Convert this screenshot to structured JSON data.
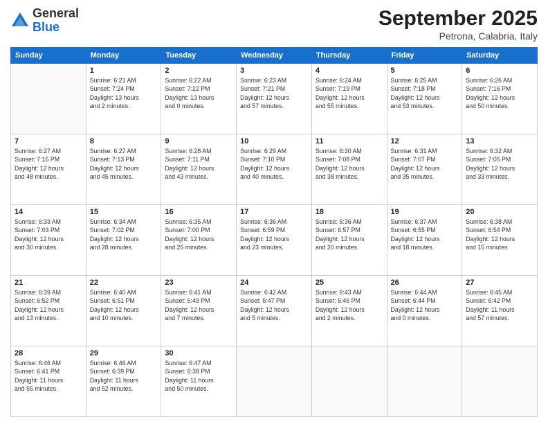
{
  "logo": {
    "general": "General",
    "blue": "Blue"
  },
  "header": {
    "month": "September 2025",
    "location": "Petrona, Calabria, Italy"
  },
  "weekdays": [
    "Sunday",
    "Monday",
    "Tuesday",
    "Wednesday",
    "Thursday",
    "Friday",
    "Saturday"
  ],
  "weeks": [
    [
      {
        "day": "",
        "info": ""
      },
      {
        "day": "1",
        "info": "Sunrise: 6:21 AM\nSunset: 7:24 PM\nDaylight: 13 hours\nand 2 minutes."
      },
      {
        "day": "2",
        "info": "Sunrise: 6:22 AM\nSunset: 7:22 PM\nDaylight: 13 hours\nand 0 minutes."
      },
      {
        "day": "3",
        "info": "Sunrise: 6:23 AM\nSunset: 7:21 PM\nDaylight: 12 hours\nand 57 minutes."
      },
      {
        "day": "4",
        "info": "Sunrise: 6:24 AM\nSunset: 7:19 PM\nDaylight: 12 hours\nand 55 minutes."
      },
      {
        "day": "5",
        "info": "Sunrise: 6:25 AM\nSunset: 7:18 PM\nDaylight: 12 hours\nand 53 minutes."
      },
      {
        "day": "6",
        "info": "Sunrise: 6:26 AM\nSunset: 7:16 PM\nDaylight: 12 hours\nand 50 minutes."
      }
    ],
    [
      {
        "day": "7",
        "info": "Sunrise: 6:27 AM\nSunset: 7:15 PM\nDaylight: 12 hours\nand 48 minutes."
      },
      {
        "day": "8",
        "info": "Sunrise: 6:27 AM\nSunset: 7:13 PM\nDaylight: 12 hours\nand 45 minutes."
      },
      {
        "day": "9",
        "info": "Sunrise: 6:28 AM\nSunset: 7:11 PM\nDaylight: 12 hours\nand 43 minutes."
      },
      {
        "day": "10",
        "info": "Sunrise: 6:29 AM\nSunset: 7:10 PM\nDaylight: 12 hours\nand 40 minutes."
      },
      {
        "day": "11",
        "info": "Sunrise: 6:30 AM\nSunset: 7:08 PM\nDaylight: 12 hours\nand 38 minutes."
      },
      {
        "day": "12",
        "info": "Sunrise: 6:31 AM\nSunset: 7:07 PM\nDaylight: 12 hours\nand 35 minutes."
      },
      {
        "day": "13",
        "info": "Sunrise: 6:32 AM\nSunset: 7:05 PM\nDaylight: 12 hours\nand 33 minutes."
      }
    ],
    [
      {
        "day": "14",
        "info": "Sunrise: 6:33 AM\nSunset: 7:03 PM\nDaylight: 12 hours\nand 30 minutes."
      },
      {
        "day": "15",
        "info": "Sunrise: 6:34 AM\nSunset: 7:02 PM\nDaylight: 12 hours\nand 28 minutes."
      },
      {
        "day": "16",
        "info": "Sunrise: 6:35 AM\nSunset: 7:00 PM\nDaylight: 12 hours\nand 25 minutes."
      },
      {
        "day": "17",
        "info": "Sunrise: 6:36 AM\nSunset: 6:59 PM\nDaylight: 12 hours\nand 23 minutes."
      },
      {
        "day": "18",
        "info": "Sunrise: 6:36 AM\nSunset: 6:57 PM\nDaylight: 12 hours\nand 20 minutes."
      },
      {
        "day": "19",
        "info": "Sunrise: 6:37 AM\nSunset: 6:55 PM\nDaylight: 12 hours\nand 18 minutes."
      },
      {
        "day": "20",
        "info": "Sunrise: 6:38 AM\nSunset: 6:54 PM\nDaylight: 12 hours\nand 15 minutes."
      }
    ],
    [
      {
        "day": "21",
        "info": "Sunrise: 6:39 AM\nSunset: 6:52 PM\nDaylight: 12 hours\nand 13 minutes."
      },
      {
        "day": "22",
        "info": "Sunrise: 6:40 AM\nSunset: 6:51 PM\nDaylight: 12 hours\nand 10 minutes."
      },
      {
        "day": "23",
        "info": "Sunrise: 6:41 AM\nSunset: 6:49 PM\nDaylight: 12 hours\nand 7 minutes."
      },
      {
        "day": "24",
        "info": "Sunrise: 6:42 AM\nSunset: 6:47 PM\nDaylight: 12 hours\nand 5 minutes."
      },
      {
        "day": "25",
        "info": "Sunrise: 6:43 AM\nSunset: 6:46 PM\nDaylight: 12 hours\nand 2 minutes."
      },
      {
        "day": "26",
        "info": "Sunrise: 6:44 AM\nSunset: 6:44 PM\nDaylight: 12 hours\nand 0 minutes."
      },
      {
        "day": "27",
        "info": "Sunrise: 6:45 AM\nSunset: 6:42 PM\nDaylight: 11 hours\nand 57 minutes."
      }
    ],
    [
      {
        "day": "28",
        "info": "Sunrise: 6:46 AM\nSunset: 6:41 PM\nDaylight: 11 hours\nand 55 minutes."
      },
      {
        "day": "29",
        "info": "Sunrise: 6:46 AM\nSunset: 6:39 PM\nDaylight: 11 hours\nand 52 minutes."
      },
      {
        "day": "30",
        "info": "Sunrise: 6:47 AM\nSunset: 6:38 PM\nDaylight: 11 hours\nand 50 minutes."
      },
      {
        "day": "",
        "info": ""
      },
      {
        "day": "",
        "info": ""
      },
      {
        "day": "",
        "info": ""
      },
      {
        "day": "",
        "info": ""
      }
    ]
  ]
}
